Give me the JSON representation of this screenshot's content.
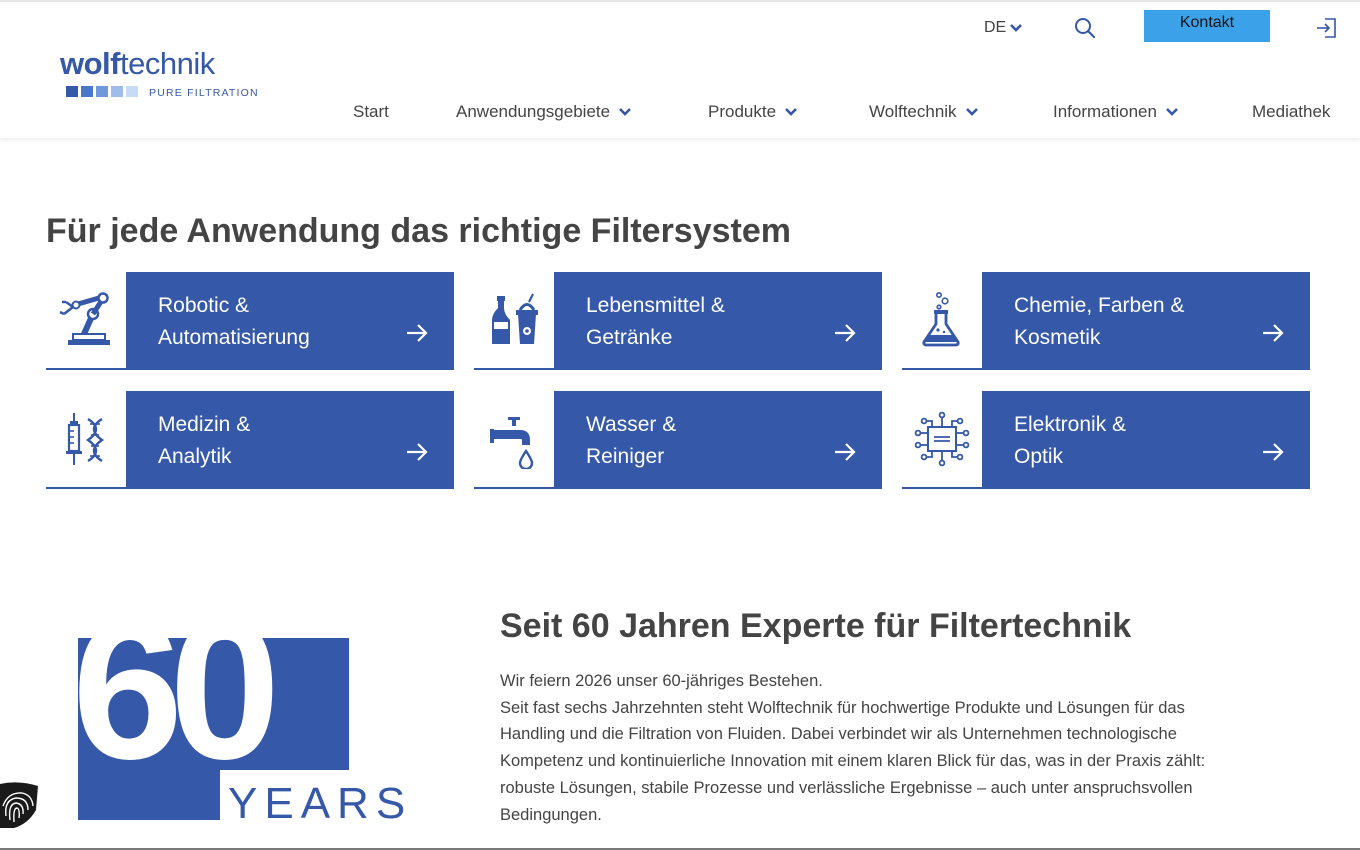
{
  "brand": {
    "name_bold": "wolf",
    "name_light": "technik",
    "tagline": "PURE FILTRATION",
    "color": "#3558a8",
    "square_colors": [
      "#3558a8",
      "#4a78c8",
      "#6f98dd",
      "#9ebcec",
      "#c6dbf6"
    ]
  },
  "topbar": {
    "language": "DE",
    "kontakt_label": "Kontakt",
    "accent": "#3ba2ea"
  },
  "nav": {
    "items": [
      {
        "label": "Start",
        "dropdown": false
      },
      {
        "label": "Anwendungsgebiete",
        "dropdown": true
      },
      {
        "label": "Produkte",
        "dropdown": true
      },
      {
        "label": "Wolftechnik",
        "dropdown": true
      },
      {
        "label": "Informationen",
        "dropdown": true
      },
      {
        "label": "Mediathek",
        "dropdown": false
      }
    ]
  },
  "applications": {
    "heading": "Für jede Anwendung das richtige Filtersystem",
    "tiles": [
      {
        "line1": "Robotic &",
        "line2": "Automatisierung",
        "icon": "robot-arm-icon"
      },
      {
        "line1": "Lebensmittel &",
        "line2": "Getränke",
        "icon": "bottles-icon"
      },
      {
        "line1": "Chemie, Farben &",
        "line2": "Kosmetik",
        "icon": "flask-icon"
      },
      {
        "line1": "Medizin &",
        "line2": "Analytik",
        "icon": "syringe-dna-icon"
      },
      {
        "line1": "Wasser &",
        "line2": "Reiniger",
        "icon": "faucet-icon"
      },
      {
        "line1": "Elektronik &",
        "line2": "Optik",
        "icon": "circuit-icon"
      }
    ]
  },
  "anniversary": {
    "badge_number": "60",
    "badge_word": "YEARS",
    "heading": "Seit 60 Jahren Experte für Filtertechnik",
    "paragraph_lines": [
      "Wir feiern 2026 unser 60-jähriges Bestehen.",
      "Seit fast sechs Jahrzehnten steht Wolftechnik für hochwertige Produkte und Lösungen für das",
      "Handling und die Filtration von Fluiden. Dabei verbindet wir als Unternehmen technologische",
      "Kompetenz und kontinuierliche Innovation mit einem klaren Blick für das, was in der Praxis zählt:",
      "robuste Lösungen, stabile Prozesse und verlässliche Ergebnisse – auch unter anspruchsvollen",
      "Bedingungen."
    ]
  }
}
